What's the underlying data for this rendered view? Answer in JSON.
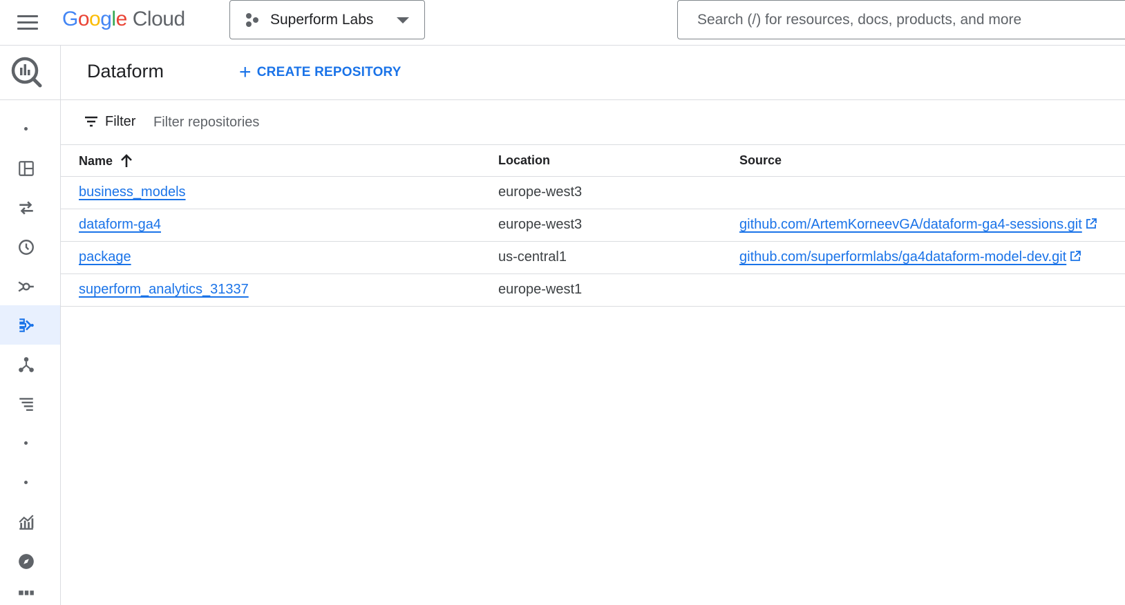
{
  "topbar": {
    "logo": {
      "letters": [
        "G",
        "o",
        "o",
        "g",
        "l",
        "e"
      ],
      "cloud": "Cloud"
    },
    "project": "Superform Labs",
    "search_placeholder": "Search (/) for resources, docs, products, and more"
  },
  "sidebar": {
    "product_icon": "bigquery-icon",
    "items": [
      {
        "icon": "dot-icon"
      },
      {
        "icon": "dashboard-icon"
      },
      {
        "icon": "transfers-icon"
      },
      {
        "icon": "scheduled-queries-icon"
      },
      {
        "icon": "analytics-hub-icon"
      },
      {
        "icon": "dataform-icon",
        "active": true
      },
      {
        "icon": "partner-center-icon"
      },
      {
        "icon": "list-icon"
      },
      {
        "icon": "dot-icon"
      },
      {
        "icon": "dot-icon"
      },
      {
        "icon": "monitoring-chart-icon"
      },
      {
        "icon": "explore-compass-icon"
      },
      {
        "icon": "grid-icon"
      }
    ]
  },
  "header": {
    "title": "Dataform",
    "create_label": "CREATE REPOSITORY"
  },
  "filter": {
    "label": "Filter",
    "placeholder": "Filter repositories"
  },
  "table": {
    "columns": [
      "Name",
      "Location",
      "Source"
    ],
    "sort": "ascending",
    "rows": [
      {
        "name": "business_models",
        "location": "europe-west3",
        "source": ""
      },
      {
        "name": "dataform-ga4",
        "location": "europe-west3",
        "source": "github.com/ArtemKorneevGA/dataform-ga4-sessions.git"
      },
      {
        "name": "package",
        "location": "us-central1",
        "source": "github.com/superformlabs/ga4dataform-model-dev.git"
      },
      {
        "name": "superform_analytics_31337",
        "location": "europe-west1",
        "source": ""
      }
    ]
  },
  "colors": {
    "accent": "#1a73e8",
    "active_nav_bg": "#e8f0fe",
    "border": "#dadce0"
  }
}
